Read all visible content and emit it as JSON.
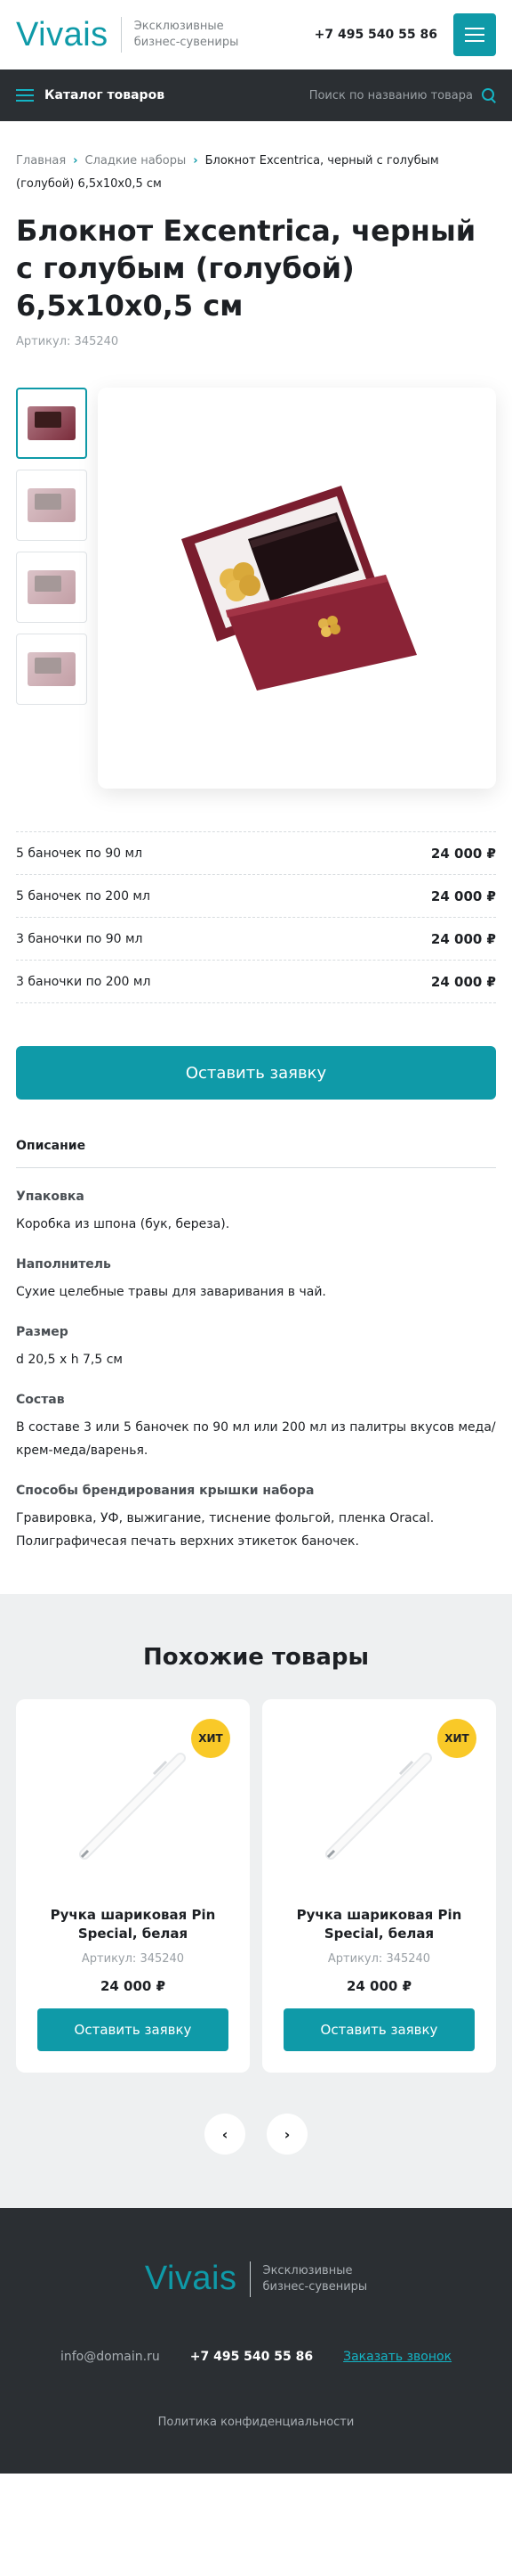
{
  "header": {
    "logo": "Vivais",
    "tagline_1": "Эксклюзивные",
    "tagline_2": "бизнес-сувениры",
    "phone": "+7 495 540 55 86"
  },
  "nav": {
    "catalog_label": "Каталог товаров",
    "search_placeholder": "Поиск по названию товара"
  },
  "breadcrumb": {
    "home": "Главная",
    "section": "Сладкие наборы",
    "current": "Блокнот Excentrica, черный с голубым (голубой) 6,5x10x0,5 см"
  },
  "product": {
    "title": "Блокнот Excentrica, черный с голубым (голубой) 6,5x10x0,5 см",
    "sku": "Артикул: 345240",
    "image_alt": "Подарочный набор в бордовой коробке"
  },
  "prices": [
    {
      "label": "5 баночек по 90 мл",
      "value": "24 000 ₽"
    },
    {
      "label": "5 баночек по 200 мл",
      "value": "24 000 ₽"
    },
    {
      "label": "3 баночки по 90 мл",
      "value": "24 000 ₽"
    },
    {
      "label": "3 баночки по 200 мл",
      "value": "24 000 ₽"
    }
  ],
  "order_button": "Оставить заявку",
  "description": {
    "title": "Описание",
    "props": [
      {
        "label": "Упаковка",
        "value": "Коробка из шпона (бук, береза)."
      },
      {
        "label": "Наполнитель",
        "value": "Сухие целебные травы для заваривания в чай."
      },
      {
        "label": "Размер",
        "value": "d 20,5 x h 7,5 см"
      },
      {
        "label": "Состав",
        "value": "В составе 3 или 5 баночек по 90 мл или 200 мл из палитры вкусов меда/крем-меда/варенья."
      },
      {
        "label": "Способы брендирования крышки набора",
        "value": "Гравировка, УФ, выжигание, тиснение фольгой, пленка Oracal. Полиграфичесая печать верхних этикеток баночек."
      }
    ]
  },
  "similar": {
    "title": "Похожие товары",
    "cards": [
      {
        "badge": "ХИТ",
        "name": "Ручка шариковая Pin Special, белая",
        "sku": "Артикул: 345240",
        "price": "24 000 ₽",
        "button": "Оставить заявку"
      },
      {
        "badge": "ХИТ",
        "name": "Ручка шариковая Pin Special, белая",
        "sku": "Артикул: 345240",
        "price": "24 000 ₽",
        "button": "Оставить заявку"
      }
    ],
    "prev": "‹",
    "next": "›"
  },
  "footer": {
    "logo": "Vivais",
    "tagline_1": "Эксклюзивные",
    "tagline_2": "бизнес-сувениры",
    "email": "info@domain.ru",
    "phone": "+7 495 540 55 86",
    "callback": "Заказать звонок",
    "policy": "Политика конфиденциальности"
  },
  "colors": {
    "accent": "#0f9aa8",
    "dark": "#2b2f33",
    "badge": "#f9c928"
  }
}
